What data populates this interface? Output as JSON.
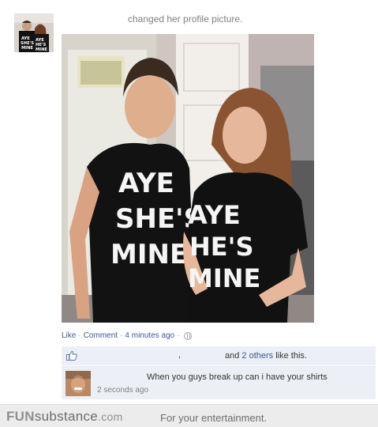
{
  "post": {
    "story_text": "changed her profile picture."
  },
  "actions": {
    "like": "Like",
    "dot1": "·",
    "comment": "Comment",
    "dot2": "·",
    "time": "4 minutes ago",
    "dot3": "·",
    "privacy_icon": "globe-icon"
  },
  "likes": {
    "comma": ",",
    "and": "and",
    "others_link": "2 others",
    "like_this": "like this.",
    "icon": "thumbs-up-icon"
  },
  "comment": {
    "text": "When you guys break up can i have your shirts",
    "time": "2 seconds ago"
  },
  "photo": {
    "shirt_left": [
      "AYE",
      "SHE'S",
      "MINE"
    ],
    "shirt_right": [
      "AYE",
      "HE'S",
      "MINE"
    ]
  },
  "footer": {
    "brand_fun": "FUN",
    "brand_sub": "substance",
    "brand_tld": ".com",
    "tagline": "For your entertainment."
  },
  "colors": {
    "link": "#3b5998",
    "ufi_bg": "#eceff5"
  }
}
